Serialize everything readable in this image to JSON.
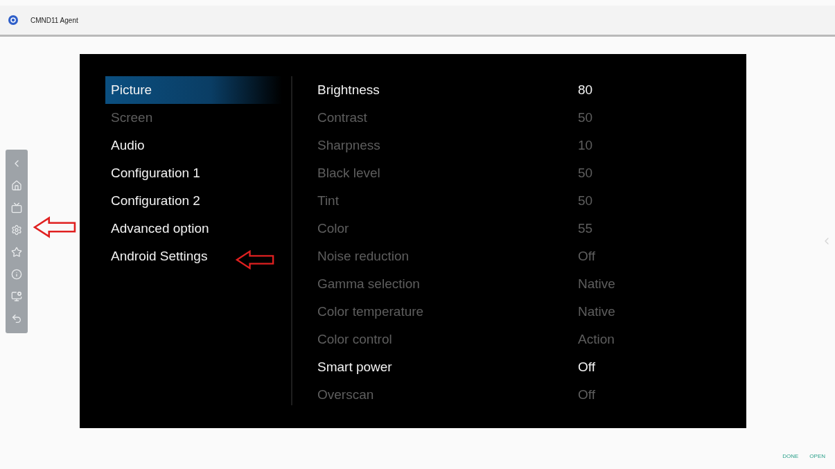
{
  "window": {
    "title": "CMND11 Agent"
  },
  "menu": [
    {
      "label": "Picture",
      "selected": true,
      "disabled": false
    },
    {
      "label": "Screen",
      "selected": false,
      "disabled": true
    },
    {
      "label": "Audio",
      "selected": false,
      "disabled": false
    },
    {
      "label": "Configuration 1",
      "selected": false,
      "disabled": false
    },
    {
      "label": "Configuration 2",
      "selected": false,
      "disabled": false
    },
    {
      "label": "Advanced option",
      "selected": false,
      "disabled": false
    },
    {
      "label": "Android Settings",
      "selected": false,
      "disabled": false
    }
  ],
  "settings": [
    {
      "label": "Brightness",
      "value": "80",
      "disabled": false
    },
    {
      "label": "Contrast",
      "value": "50",
      "disabled": true
    },
    {
      "label": "Sharpness",
      "value": "10",
      "disabled": true
    },
    {
      "label": "Black level",
      "value": "50",
      "disabled": true
    },
    {
      "label": "Tint",
      "value": "50",
      "disabled": true
    },
    {
      "label": "Color",
      "value": "55",
      "disabled": true
    },
    {
      "label": "Noise reduction",
      "value": "Off",
      "disabled": true
    },
    {
      "label": "Gamma selection",
      "value": "Native",
      "disabled": true
    },
    {
      "label": "Color temperature",
      "value": "Native",
      "disabled": true
    },
    {
      "label": "Color control",
      "value": "Action",
      "disabled": true
    },
    {
      "label": "Smart power",
      "value": "Off",
      "disabled": false
    },
    {
      "label": "Overscan",
      "value": "Off",
      "disabled": true
    }
  ],
  "footer_buttons": [
    "DONE",
    "OPEN"
  ]
}
